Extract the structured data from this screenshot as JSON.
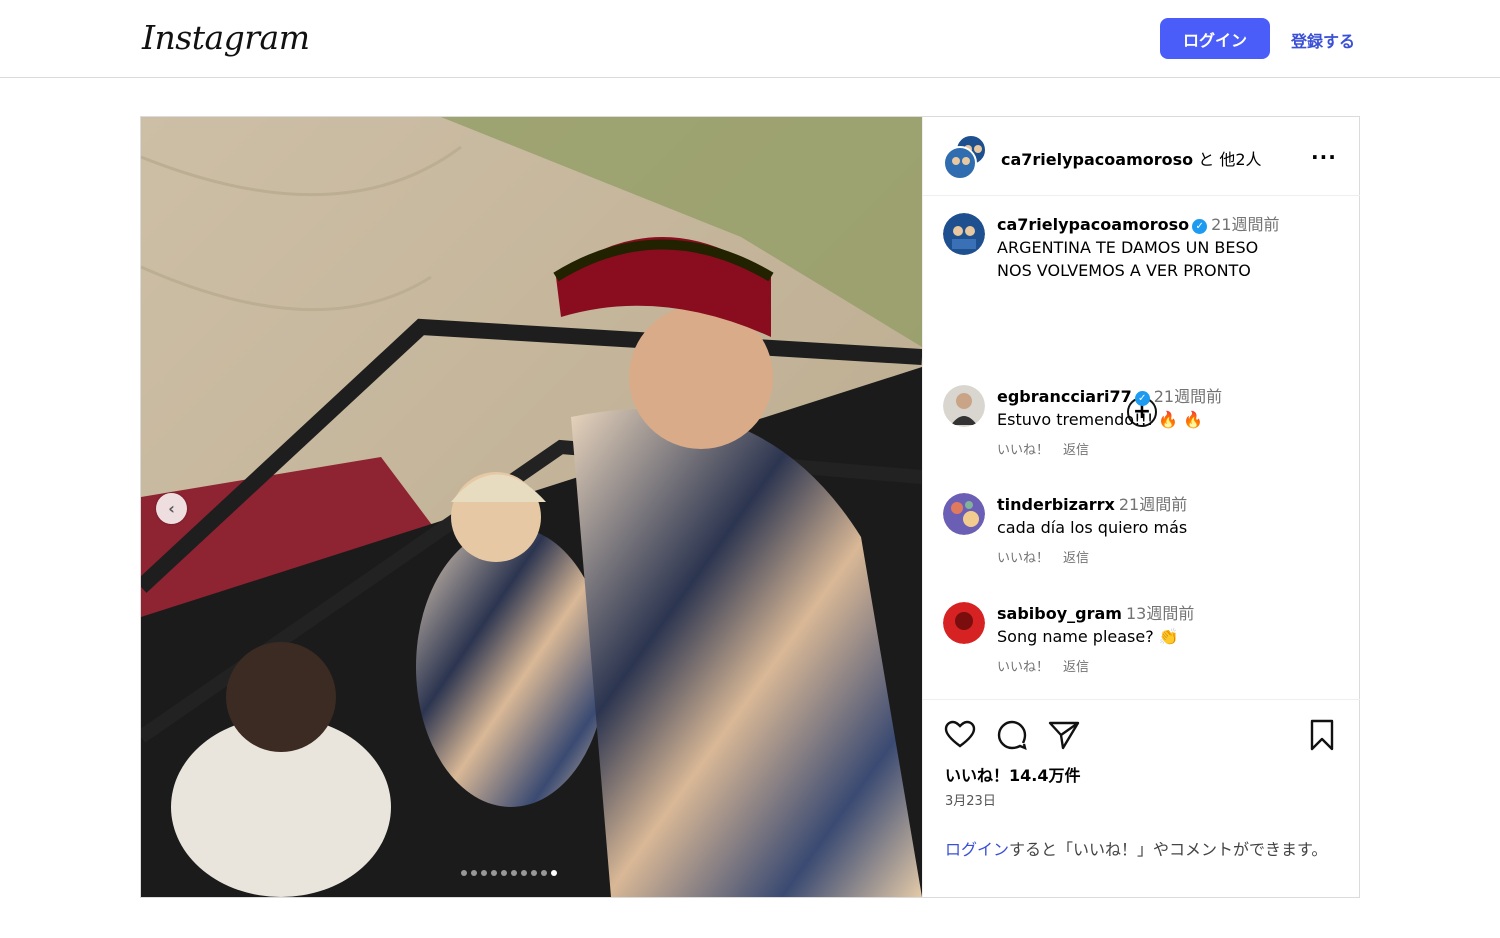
{
  "header": {
    "logo": "Instagram",
    "login_label": "ログイン",
    "signup_label": "登録する"
  },
  "post": {
    "carousel": {
      "total_slides": 10,
      "active_slide": 10
    },
    "header": {
      "username": "ca7rielypacoamoroso",
      "suffix": " と 他2人"
    },
    "caption": {
      "username": "ca7rielypacoamoroso",
      "verified": true,
      "time": "21週間前",
      "line1": "ARGENTINA TE DAMOS UN BESO",
      "line2": "NOS VOLVEMOS A VER PRONTO"
    },
    "comments": [
      {
        "username": "egbrancciari77",
        "verified": true,
        "time": "21週間前",
        "text": "Estuvo tremendo!!! 🔥 🔥",
        "like_label": "いいね！",
        "reply_label": "返信"
      },
      {
        "username": "tinderbizarrx",
        "verified": false,
        "time": "21週間前",
        "text": "cada día los quiero más",
        "like_label": "いいね！",
        "reply_label": "返信"
      },
      {
        "username": "sabiboy_gram",
        "verified": false,
        "time": "13週間前",
        "text": "Song name please? 👏",
        "like_label": "いいね！",
        "reply_label": "返信"
      }
    ],
    "likes_text": "いいね！14.4万件",
    "date": "3月23日",
    "login_prompt": {
      "link": "ログイン",
      "rest": "すると「いいね！」やコメントができます。"
    }
  },
  "colors": {
    "accent": "#4a5df9",
    "link": "#3a50d6",
    "verified": "#1d9bf0",
    "border": "#dbdbdb"
  },
  "icons": [
    "heart-icon",
    "comment-icon",
    "share-icon",
    "bookmark-icon",
    "more-icon",
    "expand-icon",
    "chevron-left-icon"
  ]
}
